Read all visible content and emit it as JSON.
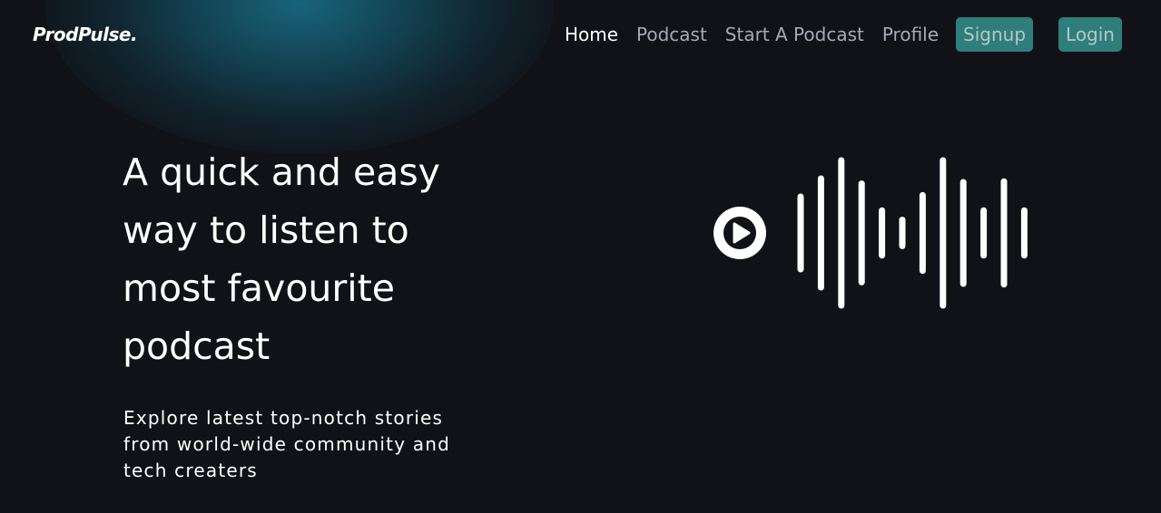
{
  "brand": {
    "logo": "ProdPulse."
  },
  "nav": {
    "home": "Home",
    "podcast": "Podcast",
    "start_podcast": "Start A Podcast",
    "profile": "Profile",
    "signup": "Signup",
    "login": "Login"
  },
  "hero": {
    "title": "A quick and easy way to listen to most favourite podcast",
    "subtitle": "Explore latest top-notch stories from world-wide community and tech creaters"
  },
  "graphic": {
    "icons": [
      "play-icon",
      "sound-wave-icon"
    ],
    "bar_levels": [
      0.5,
      0.75,
      1.0,
      0.68,
      0.31,
      0.18,
      0.52,
      1.0,
      0.7,
      0.31,
      0.71,
      0.31
    ]
  },
  "colors": {
    "background": "#111217",
    "accent": "#2e7e7b",
    "glow": "#186880",
    "nav_text": "#a9a8b6",
    "text": "#ffffff"
  }
}
